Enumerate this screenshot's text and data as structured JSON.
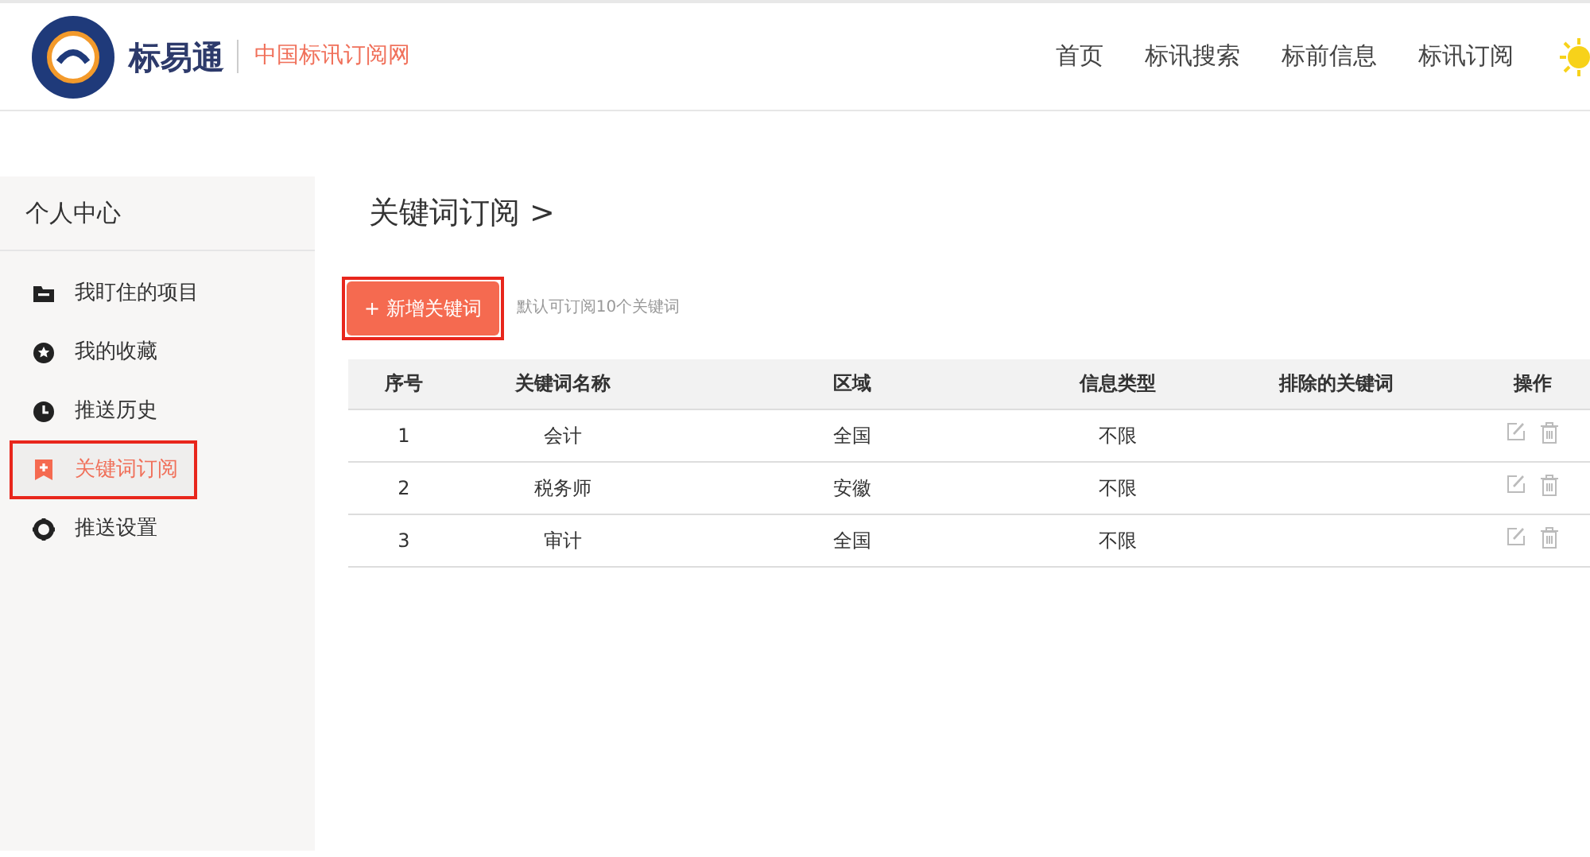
{
  "header": {
    "brand": "标易通",
    "tagline": "中国标讯订阅网",
    "nav": [
      {
        "label": "首页"
      },
      {
        "label": "标讯搜索"
      },
      {
        "label": "标前信息"
      },
      {
        "label": "标讯订阅"
      }
    ]
  },
  "sidebar": {
    "title": "个人中心",
    "items": [
      {
        "label": "我盯住的项目",
        "kind": "folder",
        "selected": false,
        "annotated": false
      },
      {
        "label": "我的收藏",
        "kind": "star",
        "selected": false,
        "annotated": false
      },
      {
        "label": "推送历史",
        "kind": "clock",
        "selected": false,
        "annotated": false
      },
      {
        "label": "关键词订阅",
        "kind": "bookmark",
        "selected": true,
        "annotated": true
      },
      {
        "label": "推送设置",
        "kind": "gear",
        "selected": false,
        "annotated": false
      }
    ]
  },
  "main": {
    "title": "关键词订阅 >",
    "add_button": {
      "label": "+ 新增关键词",
      "annotated": true
    },
    "hint": "默认可订阅10个关键词",
    "table": {
      "columns": [
        "序号",
        "关键词名称",
        "区域",
        "信息类型",
        "排除的关键词",
        "操作"
      ],
      "rows": [
        {
          "index": "1",
          "keyword": "会计",
          "region": "全国",
          "info_type": "不限"
        },
        {
          "index": "2",
          "keyword": "税务师",
          "region": "安徽",
          "info_type": "不限"
        },
        {
          "index": "3",
          "keyword": "审计",
          "region": "全国",
          "info_type": "不限"
        }
      ]
    }
  }
}
